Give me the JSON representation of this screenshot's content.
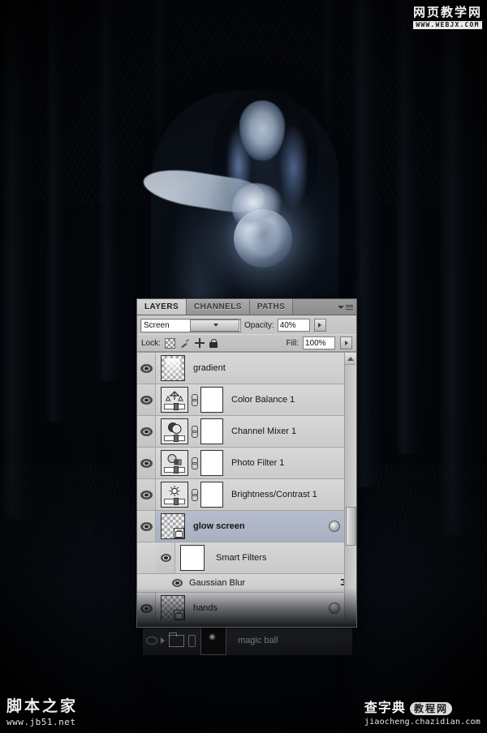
{
  "app": "Adobe Photoshop",
  "artwork": {
    "description": "Dark fantasy photo manipulation: hooded witch in a night forest holding a glowing magic ball"
  },
  "panel": {
    "tabs": [
      {
        "label": "LAYERS",
        "active": true
      },
      {
        "label": "CHANNELS",
        "active": false
      },
      {
        "label": "PATHS",
        "active": false
      }
    ],
    "menu_icon": "panel-menu-icon",
    "blend_mode": "Screen",
    "opacity_label": "Opacity:",
    "opacity_value": "40%",
    "lock_label": "Lock:",
    "lock_icons": [
      "lock-transparent-pixels-icon",
      "lock-image-pixels-icon",
      "lock-position-icon",
      "lock-all-icon"
    ],
    "fill_label": "Fill:",
    "fill_value": "100%",
    "layers": [
      {
        "name": "gradient",
        "type": "pixel",
        "visible": true,
        "selected": false,
        "thumb": "checker-gradient",
        "has_mask": false,
        "has_link": false,
        "smart_object": false,
        "indent": 0
      },
      {
        "name": "Color Balance 1",
        "type": "adjustment",
        "visible": true,
        "selected": false,
        "thumb": "color-balance-icon",
        "has_mask": true,
        "has_link": true,
        "smart_object": false,
        "indent": 0
      },
      {
        "name": "Channel Mixer 1",
        "type": "adjustment",
        "visible": true,
        "selected": false,
        "thumb": "channel-mixer-icon",
        "has_mask": true,
        "has_link": true,
        "smart_object": false,
        "indent": 0
      },
      {
        "name": "Photo Filter 1",
        "type": "adjustment",
        "visible": true,
        "selected": false,
        "thumb": "photo-filter-icon",
        "has_mask": true,
        "has_link": true,
        "smart_object": false,
        "indent": 0
      },
      {
        "name": "Brightness/Contrast 1",
        "type": "adjustment",
        "visible": true,
        "selected": false,
        "thumb": "brightness-contrast-icon",
        "has_mask": true,
        "has_link": true,
        "smart_object": false,
        "indent": 0
      },
      {
        "name": "glow screen",
        "type": "smart",
        "visible": true,
        "selected": true,
        "thumb": "checker-smart-object",
        "has_mask": false,
        "has_link": false,
        "smart_object": true,
        "indent": 0
      },
      {
        "name": "Smart Filters",
        "type": "smart-filters-header",
        "visible": true,
        "selected": false,
        "thumb": "white-mask",
        "has_mask": false,
        "has_link": false,
        "smart_object": false,
        "indent": 1
      },
      {
        "name": "Gaussian Blur",
        "type": "smart-filter",
        "visible": true,
        "selected": false,
        "thumb": null,
        "has_mask": false,
        "has_link": false,
        "smart_object": false,
        "indent": 2
      },
      {
        "name": "hands",
        "type": "smart",
        "visible": true,
        "selected": false,
        "thumb": "checker-smart-object",
        "has_mask": false,
        "has_link": false,
        "smart_object": true,
        "indent": 0
      }
    ],
    "ghost_row": {
      "name": "magic ball",
      "type": "group"
    },
    "scrollbar": {
      "up_arrow": "scroll-up-arrow-icon"
    }
  },
  "watermarks": {
    "top_right": {
      "cn": "网页教学网",
      "en": "WWW.WEBJX.COM"
    },
    "bottom_left": {
      "cn": "脚本之家",
      "en": "www.jb51.net"
    },
    "bottom_right": {
      "cn1": "查字典",
      "cn2": "教程网",
      "en": "jiaocheng.chazidian.com"
    }
  },
  "colors": {
    "panel_bg": "#c8c8c8",
    "row_selected": "#b0b8c8",
    "artwork_dark": "#05080e",
    "glow_blue": "#b9d2f0"
  }
}
